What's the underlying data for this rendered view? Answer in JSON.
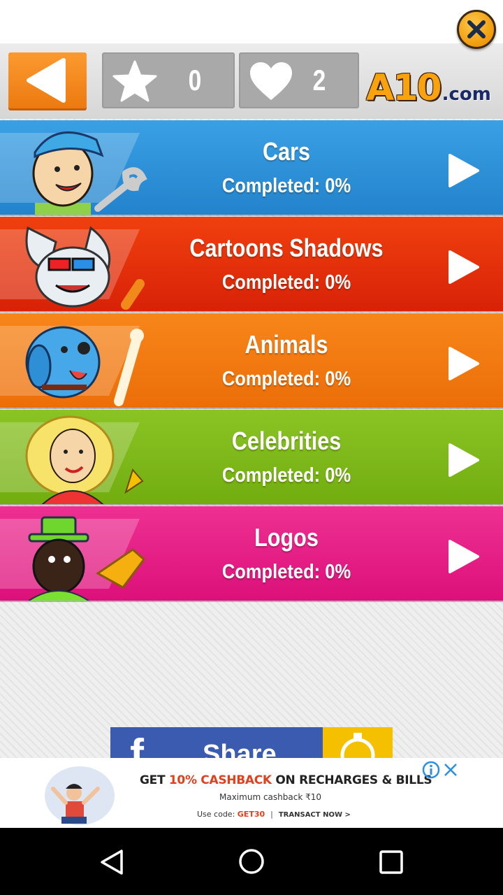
{
  "header": {
    "stars_count": "0",
    "hearts_count": "2",
    "logo_main": "A10",
    "logo_suffix": ".com"
  },
  "categories": [
    {
      "title": "Cars",
      "progress": "Completed: 0%",
      "color": "#2d8fd6"
    },
    {
      "title": "Cartoons Shadows",
      "progress": "Completed: 0%",
      "color": "#e5300e"
    },
    {
      "title": "Animals",
      "progress": "Completed: 0%",
      "color": "#f07810"
    },
    {
      "title": "Celebrities",
      "progress": "Completed: 0%",
      "color": "#7fb81a"
    },
    {
      "title": "Logos",
      "progress": "Completed: 0%",
      "color": "#e61a82"
    }
  ],
  "share": {
    "label": "Share",
    "icon": "f"
  },
  "ad": {
    "line1_pre": "GET ",
    "line1_hl": "10% CASHBACK",
    "line1_post": " ON RECHARGES & BILLS",
    "line2": "Maximum cashback ₹10",
    "line3_pre": "Use code: ",
    "line3_code": "GET30",
    "line3_sep": "|",
    "line3_cta": "TRANSACT NOW >"
  },
  "colors": {
    "back": "#f08a1a",
    "facebook": "#3b5bb0",
    "accent_yellow": "#f5c000"
  }
}
